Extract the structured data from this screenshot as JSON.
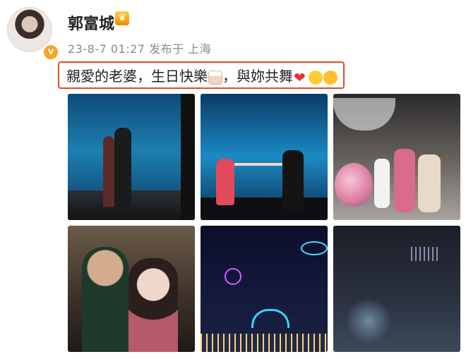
{
  "post": {
    "username": "郭富城",
    "vip_badge_icon": "crown-icon",
    "verified_icon": "verified-badge-icon",
    "timestamp": "23-8-7 01:27",
    "source_label": "发布于 上海",
    "text": "親愛的老婆，生日快樂",
    "text_part2": "，與妳共舞",
    "emojis": [
      "cake-emoji",
      "heart-emoji",
      "smile-emoji",
      "blowing-kiss-emoji"
    ],
    "highlight_color": "#e24a2b"
  },
  "photos": [
    {
      "label": "",
      "watermark": ""
    },
    {
      "label": "",
      "watermark": ""
    },
    {
      "label": "",
      "watermark": ""
    },
    {
      "label": "",
      "watermark": ""
    },
    {
      "label": "",
      "watermark": ""
    },
    {
      "label": "",
      "watermark": ""
    }
  ]
}
